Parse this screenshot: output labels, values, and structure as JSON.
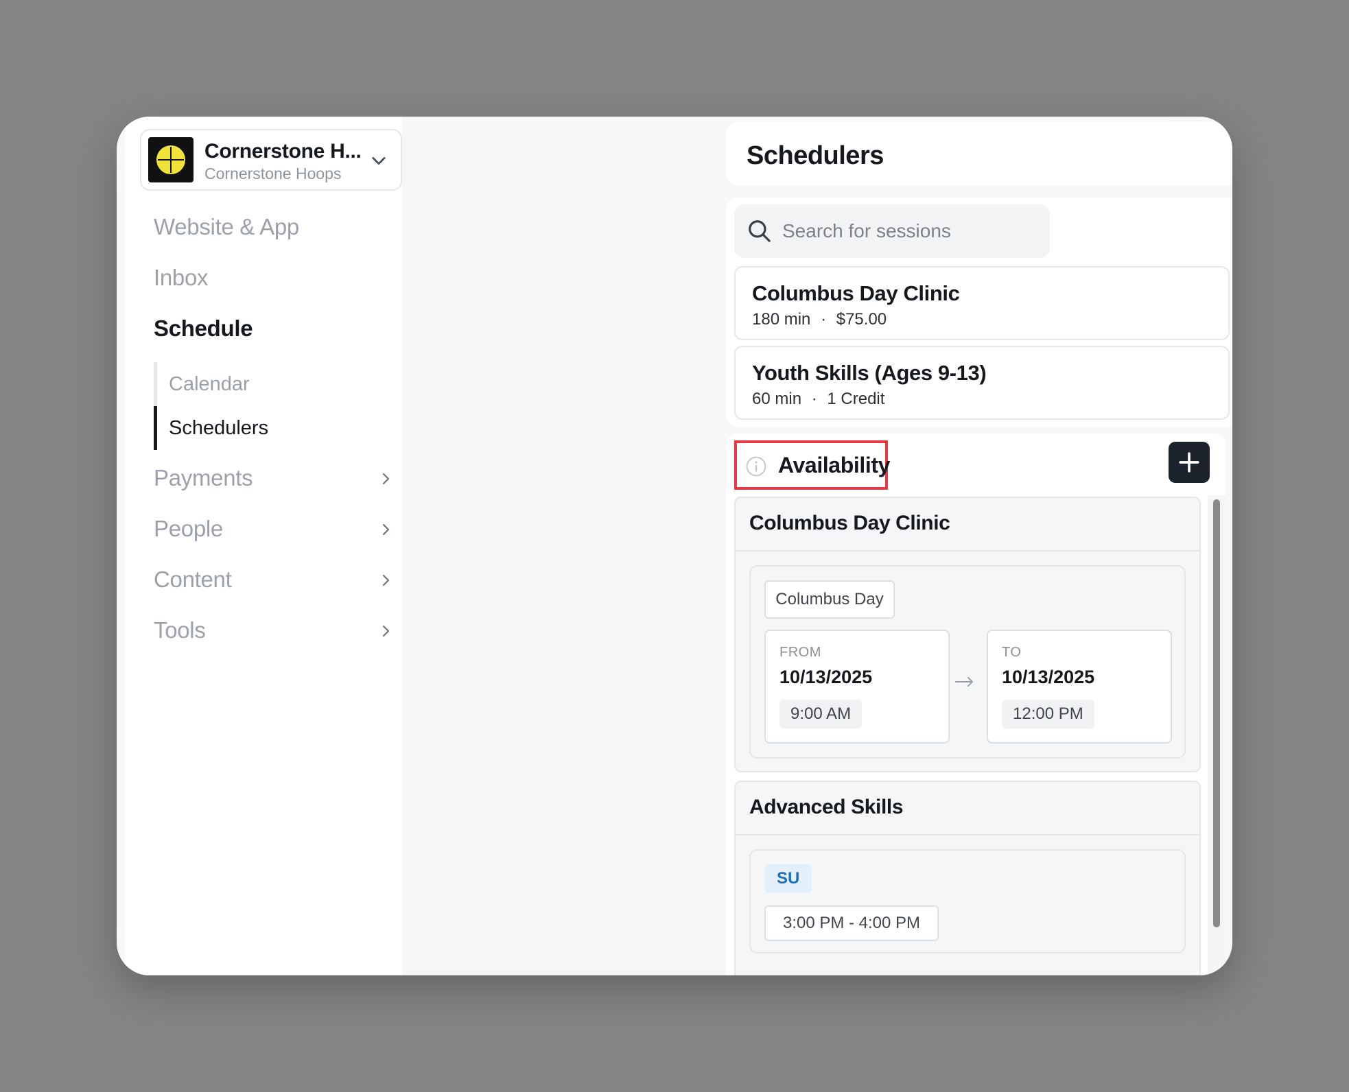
{
  "org": {
    "name": "Cornerstone H...",
    "subtitle": "Cornerstone Hoops"
  },
  "nav": {
    "website_app": "Website & App",
    "inbox": "Inbox",
    "schedule": "Schedule",
    "schedule_sub": {
      "calendar": "Calendar",
      "schedulers": "Schedulers"
    },
    "payments": "Payments",
    "people": "People",
    "content": "Content",
    "tools": "Tools"
  },
  "panel": {
    "title": "Schedulers",
    "search_placeholder": "Search for sessions",
    "sessions": [
      {
        "title": "Columbus Day Clinic",
        "duration": "180 min",
        "price": "$75.00"
      },
      {
        "title": "Youth Skills (Ages 9-13)",
        "duration": "60 min",
        "price": "1 Credit"
      }
    ],
    "separator": "·"
  },
  "availability": {
    "title": "Availability",
    "groups": [
      {
        "title": "Columbus Day Clinic",
        "chip": "Columbus Day",
        "from_label": "FROM",
        "from_date": "10/13/2025",
        "from_time": "9:00 AM",
        "to_label": "TO",
        "to_date": "10/13/2025",
        "to_time": "12:00 PM"
      },
      {
        "title": "Advanced Skills",
        "day": "SU",
        "time_range": "3:00 PM - 4:00 PM"
      }
    ]
  },
  "colors": {
    "highlight": "#e63946",
    "accent_dark": "#1c222b",
    "day_badge": "#1f6fb8"
  }
}
